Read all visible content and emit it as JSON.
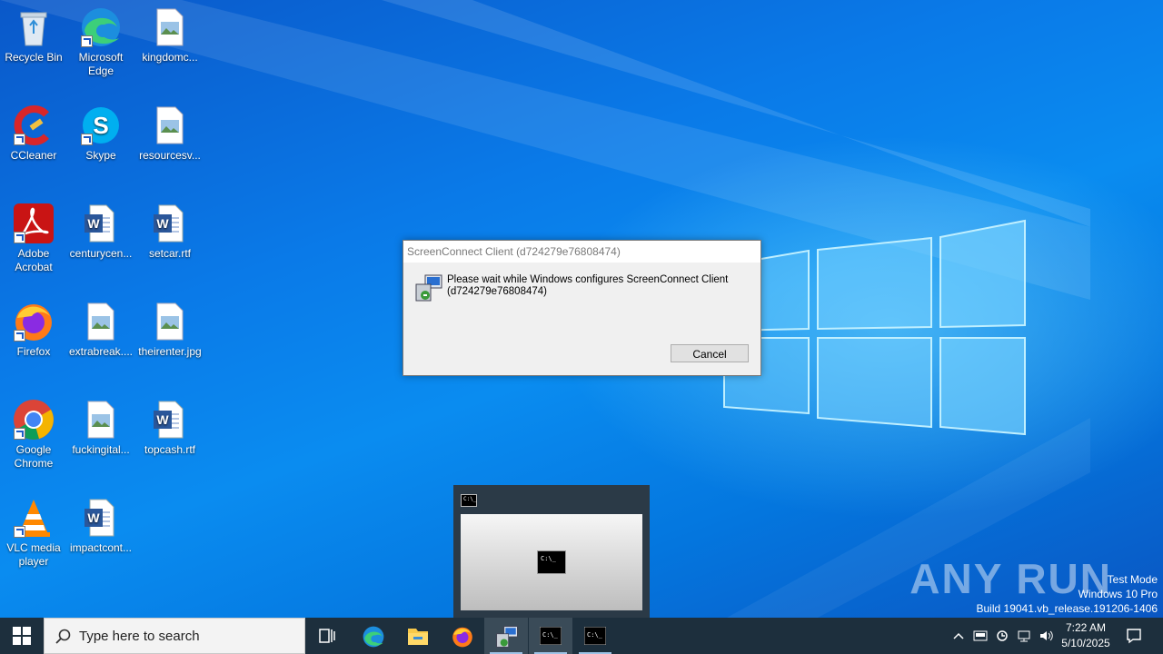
{
  "desktop": {
    "icons": [
      {
        "label": "Recycle Bin",
        "icon": "recycle-bin-icon"
      },
      {
        "label": "Microsoft Edge",
        "icon": "edge-icon"
      },
      {
        "label": "kingdomc...",
        "icon": "image-file-icon"
      },
      {
        "label": "CCleaner",
        "icon": "ccleaner-icon"
      },
      {
        "label": "Skype",
        "icon": "skype-icon"
      },
      {
        "label": "resourcesv...",
        "icon": "image-file-icon"
      },
      {
        "label": "Adobe Acrobat",
        "icon": "acrobat-icon"
      },
      {
        "label": "centurycen...",
        "icon": "word-document-icon"
      },
      {
        "label": "setcar.rtf",
        "icon": "word-document-icon"
      },
      {
        "label": "Firefox",
        "icon": "firefox-icon"
      },
      {
        "label": "extrabreak....",
        "icon": "image-file-icon"
      },
      {
        "label": "theirenter.jpg",
        "icon": "image-file-icon"
      },
      {
        "label": "Google Chrome",
        "icon": "chrome-icon"
      },
      {
        "label": "fuckingital...",
        "icon": "image-file-icon"
      },
      {
        "label": "topcash.rtf",
        "icon": "word-document-icon"
      },
      {
        "label": "VLC media player",
        "icon": "vlc-icon"
      },
      {
        "label": "impactcont...",
        "icon": "word-document-icon"
      }
    ]
  },
  "dialog": {
    "title": "ScreenConnect Client (d724279e76808474)",
    "message": "Please wait while Windows configures ScreenConnect Client (d724279e76808474)",
    "cancel_label": "Cancel"
  },
  "thumbnail": {
    "icon_text": "C:\\_",
    "preview_text": "C:\\_"
  },
  "watermark": {
    "logo": "ANY RUN",
    "line1": "Test Mode",
    "line2": "Windows 10 Pro",
    "line3": "Build 19041.vb_release.191206-1406"
  },
  "taskbar": {
    "search_placeholder": "Type here to search",
    "apps": [
      "task-view-icon",
      "edge-icon",
      "file-explorer-icon",
      "firefox-icon",
      "installer-icon",
      "cmd-icon",
      "cmd-icon"
    ],
    "time": "7:22 AM",
    "date": "5/10/2025"
  }
}
